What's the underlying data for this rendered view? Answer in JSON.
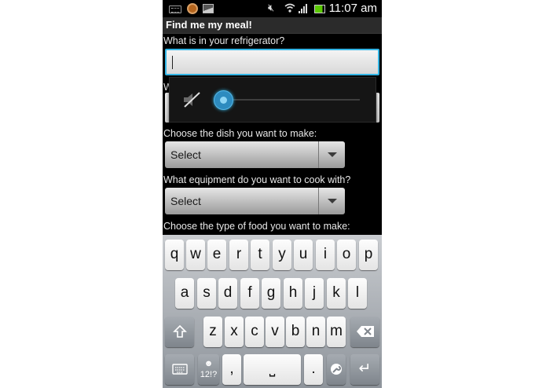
{
  "status_bar": {
    "time": "11:07 am",
    "icons": [
      "keyboard-notification-icon",
      "app-notification-icon",
      "image-notification-icon",
      "mute-icon",
      "wifi-icon",
      "signal-icon",
      "battery-icon"
    ],
    "battery_color": "#5ac800"
  },
  "app": {
    "title": "Find me my meal!"
  },
  "form": {
    "fridge_label": "What is in your refrigerator?",
    "fridge_value": "",
    "dish_label": "Choose the dish you want to make:",
    "dish_value": "Select",
    "equipment_label": "What equipment do you want to cook with?",
    "equipment_value": "Select",
    "food_type_label": "Choose the type of food you want to make:"
  },
  "volume": {
    "muted": true,
    "level": 0.0,
    "accent": "#33b5e5"
  },
  "keyboard": {
    "row1": [
      "q",
      "w",
      "e",
      "r",
      "t",
      "y",
      "u",
      "i",
      "o",
      "p"
    ],
    "row2": [
      "a",
      "s",
      "d",
      "f",
      "g",
      "h",
      "j",
      "k",
      "l"
    ],
    "row3": [
      "z",
      "x",
      "c",
      "v",
      "b",
      "n",
      "m"
    ],
    "symbols_key_top": "☻",
    "symbols_key": "12!?",
    "comma": ",",
    "period": ".",
    "space_symbol": "⎵",
    "enter_symbol": "↵"
  }
}
